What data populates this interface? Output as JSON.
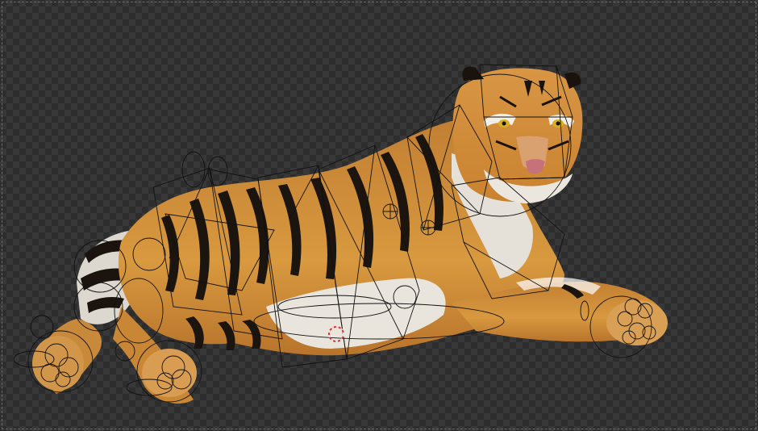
{
  "viewport": {
    "background": "transparent-checkerboard",
    "checker_light": "#383838",
    "checker_dark": "#2d2d2d"
  },
  "subject": {
    "name": "tiger-model",
    "pose": "lying",
    "fur_color": "#c98a3a",
    "stripe_color": "#1c140e",
    "belly_color": "#e8e4dc"
  },
  "rig": {
    "display": "wire",
    "wire_color": "#151515",
    "cursor_color": "#e23a3a"
  }
}
